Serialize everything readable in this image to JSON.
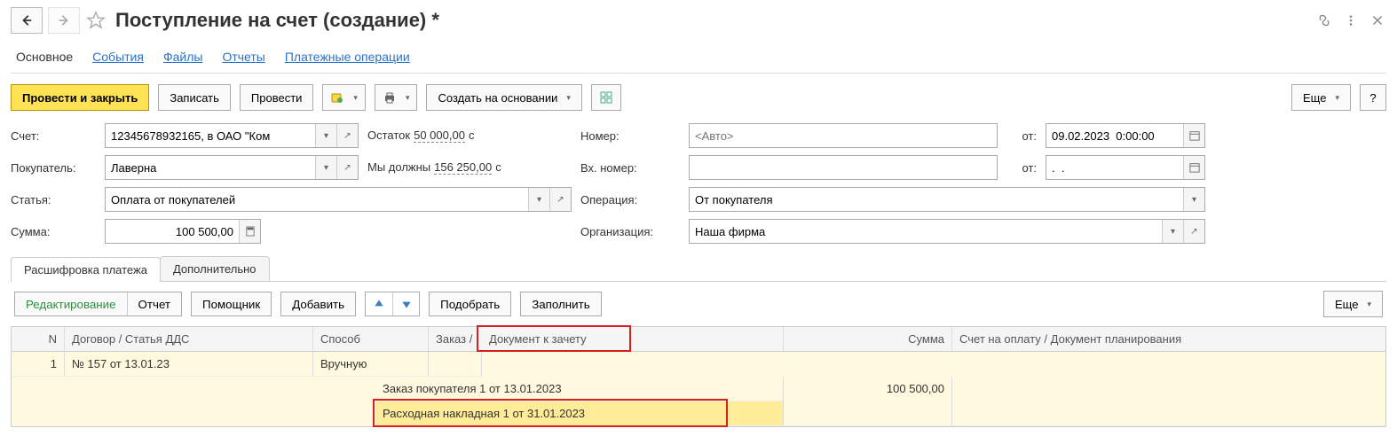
{
  "header": {
    "title": "Поступление на счет (создание) *"
  },
  "nav": {
    "tabs": [
      "Основное",
      "События",
      "Файлы",
      "Отчеты",
      "Платежные операции"
    ],
    "active": 0
  },
  "toolbar": {
    "post_close": "Провести и закрыть",
    "write": "Записать",
    "post": "Провести",
    "create_based": "Создать на основании",
    "more": "Еще",
    "help": "?"
  },
  "form": {
    "account_label": "Счет:",
    "account_value": "12345678932165, в ОАО \"Ком",
    "balance_label": "Остаток",
    "balance_value": "50 000,00",
    "balance_cur": "с",
    "number_label": "Номер:",
    "number_placeholder": "<Авто>",
    "from_label": "от:",
    "date_value": "09.02.2023  0:00:00",
    "buyer_label": "Покупатель:",
    "buyer_value": "Лаверна",
    "we_owe_label": "Мы должны",
    "we_owe_value": "156 250,00",
    "we_owe_cur": "с",
    "ext_number_label": "Вх. номер:",
    "ext_number_value": "",
    "ext_from_label": "от:",
    "ext_date_value": ".  .",
    "article_label": "Статья:",
    "article_value": "Оплата от покупателей",
    "operation_label": "Операция:",
    "operation_value": "От покупателя",
    "sum_label": "Сумма:",
    "sum_value": "100 500,00",
    "org_label": "Организация:",
    "org_value": "Наша фирма"
  },
  "subtabs": {
    "payment": "Расшифровка платежа",
    "additional": "Дополнительно"
  },
  "sub_toolbar": {
    "edit": "Редактирование",
    "report": "Отчет",
    "helper": "Помощник",
    "add": "Добавить",
    "pick": "Подобрать",
    "fill": "Заполнить",
    "more": "Еще"
  },
  "table": {
    "headers": {
      "n": "N",
      "contract": "Договор / Статья ДДС",
      "method": "Способ",
      "order": "Заказ /",
      "doc_offset": "Документ к зачету",
      "sum": "Сумма",
      "invoice": "Счет на оплату / Документ планирования"
    },
    "rows": [
      {
        "n": "1",
        "contract": "№ 157 от 13.01.23",
        "method": "Вручную",
        "doc1": "Заказ покупателя 1 от 13.01.2023",
        "doc2": "Расходная накладная 1 от 31.01.2023",
        "sum": "100 500,00",
        "invoice": ""
      }
    ]
  }
}
